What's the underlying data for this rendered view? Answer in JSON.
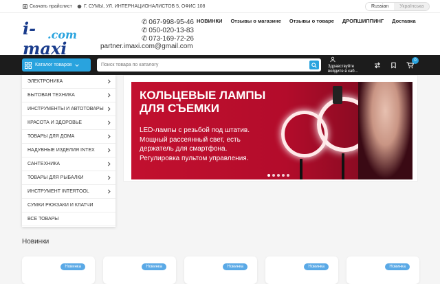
{
  "topbar": {
    "pricelist": "Скачать прайслист",
    "address": "Г. СУМЫ, УЛ. ИНТЕРНАЦИОНАЛИСТОВ 5, ОФИС 108",
    "lang_active": "Russian",
    "lang_other": "Українська"
  },
  "header": {
    "logo_main": "i-maxi",
    "logo_sub": ".com",
    "phones": [
      "067-998-95-46",
      "050-020-13-83",
      "073-169-72-26"
    ],
    "email": "partner.imaxi.com@gmail.com",
    "nav": [
      "НОВИНКИ",
      "Отзывы о магазине",
      "Отзывы о товаре",
      "ДРОПШИППИНГ",
      "Доставка"
    ]
  },
  "toolbar": {
    "catalog_label": "Каталог товаров",
    "search_placeholder": "Поиск товара по каталогу",
    "login_line1": "Здравствуйте",
    "login_line2": "войдите в каб...",
    "cart_count": "0"
  },
  "sidebar": {
    "items": [
      {
        "label": "ЭЛЕКТРОНИКА",
        "has_children": true
      },
      {
        "label": "БЫТОВАЯ ТЕХНИКА",
        "has_children": true
      },
      {
        "label": "ИНСТРУМЕНТЫ И АВТОТОВАРЫ",
        "has_children": true
      },
      {
        "label": "КРАСОТА И ЗДОРОВЬЕ",
        "has_children": true
      },
      {
        "label": "ТОВАРЫ ДЛЯ ДОМА",
        "has_children": true
      },
      {
        "label": "НАДУВНЫЕ ИЗДЕЛИЯ INTEX",
        "has_children": true
      },
      {
        "label": "САНТЕХНИКА",
        "has_children": true
      },
      {
        "label": "ТОВАРЫ ДЛЯ РЫБАЛКИ",
        "has_children": true
      },
      {
        "label": "ИНСТРУМЕНТ INTERTOOL",
        "has_children": true
      },
      {
        "label": "СУМКИ РЮКЗАКИ И КЛАТЧИ",
        "has_children": false
      },
      {
        "label": "ВСЕ ТОВАРЫ",
        "has_children": false
      }
    ]
  },
  "banner": {
    "headline_1": "КОЛЬЦЕВЫЕ ЛАМПЫ",
    "headline_2": "ДЛЯ СЪЕМКИ",
    "text": [
      "LED-лампы с резьбой под штатив.",
      "Мощный рассеянный свет, есть",
      "держатель для смартфона.",
      "Регулировка пультом управления."
    ],
    "slide_count": 5,
    "active_slide": 0
  },
  "new_section": {
    "title": "Новинки",
    "cards": [
      {
        "badge": "Новинка"
      },
      {
        "badge": "Новинка"
      },
      {
        "badge": "Новинка"
      },
      {
        "badge": "Новинка"
      },
      {
        "badge": "Новинка"
      }
    ]
  },
  "colors": {
    "accent": "#29a3de",
    "dark_bar": "#1c1c1c",
    "banner_red": "#c2102f"
  }
}
